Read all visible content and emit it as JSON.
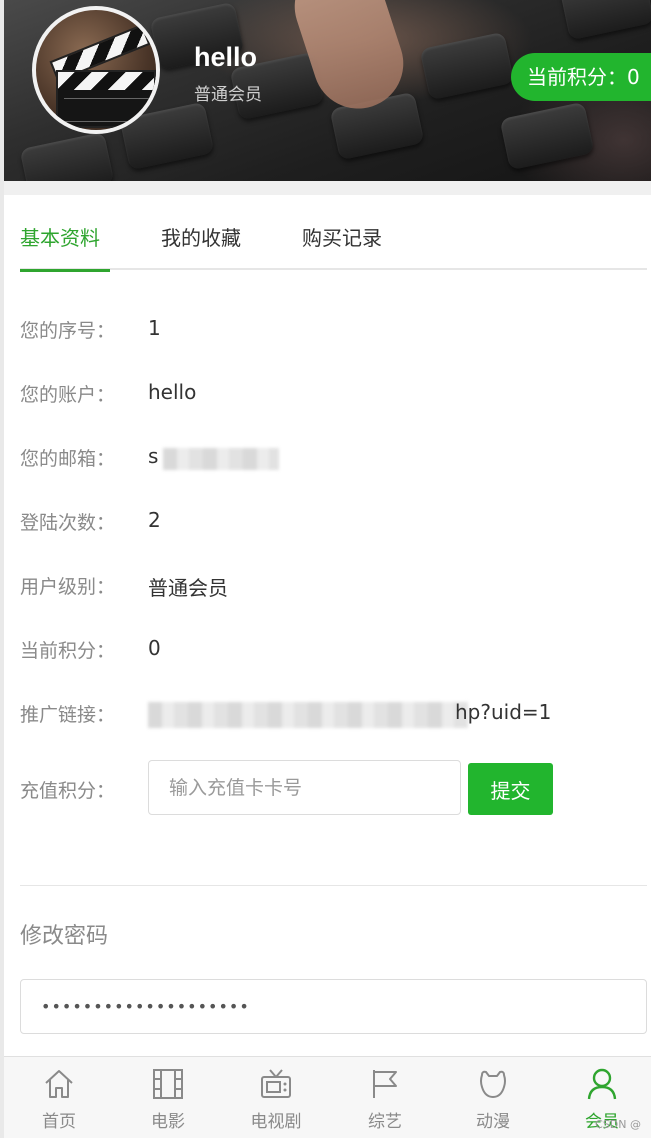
{
  "header": {
    "username": "hello",
    "user_level": "普通会员",
    "points_label": "当前积分：0"
  },
  "tabs": [
    {
      "label": "基本资料",
      "active": true
    },
    {
      "label": "我的收藏",
      "active": false
    },
    {
      "label": "购买记录",
      "active": false
    }
  ],
  "profile": {
    "serial_label": "您的序号：",
    "serial_value": "1",
    "account_label": "您的账户：",
    "account_value": "hello",
    "email_label": "您的邮箱：",
    "email_value": "s",
    "login_count_label": "登陆次数：",
    "login_count_value": "2",
    "level_label": "用户级别：",
    "level_value": "普通会员",
    "points_label": "当前积分：",
    "points_value": "0",
    "promo_label": "推广链接：",
    "promo_value": "hp?uid=1",
    "recharge_label": "充值积分："
  },
  "recharge": {
    "placeholder": "输入充值卡卡号",
    "submit_label": "提交"
  },
  "password": {
    "section_title": "修改密码",
    "value": "••••••••••••••••••••"
  },
  "bottom_nav": [
    {
      "label": "首页",
      "icon": "home-icon",
      "active": false
    },
    {
      "label": "电影",
      "icon": "film-icon",
      "active": false
    },
    {
      "label": "电视剧",
      "icon": "tv-icon",
      "active": false
    },
    {
      "label": "综艺",
      "icon": "flag-icon",
      "active": false
    },
    {
      "label": "动漫",
      "icon": "anime-icon",
      "active": false
    },
    {
      "label": "会员",
      "icon": "user-icon",
      "active": true
    }
  ],
  "watermark": "CSDN @",
  "colors": {
    "accent": "#22b52e",
    "active_tab": "#2fa52f",
    "label_gray": "#8a8a8a"
  }
}
